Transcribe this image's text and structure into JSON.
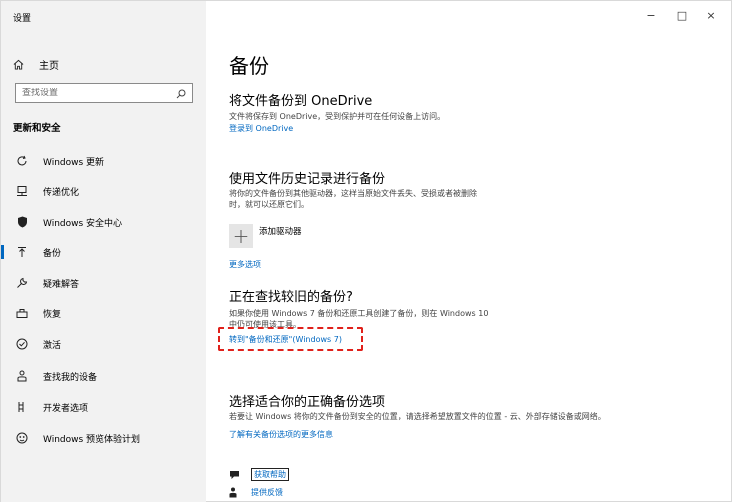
{
  "window": {
    "title": "设置",
    "controls": {
      "minimize": "−",
      "maximize": "□",
      "close": "×"
    }
  },
  "sidebar": {
    "home": "主页",
    "search_placeholder": "查找设置",
    "section": "更新和安全",
    "items": [
      {
        "label": "Windows 更新",
        "icon": "refresh-icon"
      },
      {
        "label": "传递优化",
        "icon": "delivery-icon"
      },
      {
        "label": "Windows 安全中心",
        "icon": "shield-icon"
      },
      {
        "label": "备份",
        "icon": "backup-icon",
        "active": true
      },
      {
        "label": "疑难解答",
        "icon": "wrench-icon"
      },
      {
        "label": "恢复",
        "icon": "recovery-icon"
      },
      {
        "label": "激活",
        "icon": "check-circle-icon"
      },
      {
        "label": "查找我的设备",
        "icon": "person-location-icon"
      },
      {
        "label": "开发者选项",
        "icon": "developer-icon"
      },
      {
        "label": "Windows 预览体验计划",
        "icon": "insider-icon"
      }
    ],
    "accent_color": "#0067c0"
  },
  "main": {
    "title": "备份",
    "onedrive": {
      "heading": "将文件备份到 OneDrive",
      "text": "文件将保存到 OneDrive，受到保护并可在任何设备上访问。",
      "link": "登录到 OneDrive"
    },
    "history": {
      "heading": "使用文件历史记录进行备份",
      "text_line1": "将你的文件备份到其他驱动器，这样当原始文件丢失、受损或者被删除",
      "text_line2": "时，就可以还原它们。",
      "add_drive": "添加驱动器",
      "more_options": "更多选项"
    },
    "older": {
      "heading": "正在查找较旧的备份?",
      "text_line1": "如果你使用 Windows 7 备份和还原工具创建了备份，则在 Windows 10",
      "text_line2": "中仍可使用该工具。",
      "link": "转到\"备份和还原\"(Windows 7)"
    },
    "right_option": {
      "heading": "选择适合你的正确备份选项",
      "text": "若要让 Windows 将你的文件备份到安全的位置，请选择希望放置文件的位置 - 云、外部存储设备或网络。",
      "link": "了解有关备份选项的更多信息"
    },
    "help": {
      "get_help": "获取帮助",
      "feedback": "提供反馈"
    },
    "highlight_color": "#e0211b",
    "link_color": "#0067c0"
  }
}
